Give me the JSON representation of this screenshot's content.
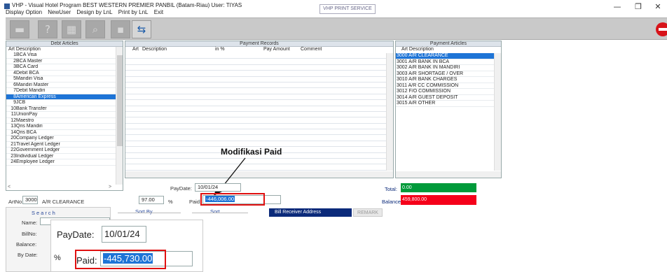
{
  "title_bar": {
    "text": "VHP - Visual Hotel Program      BEST WESTERN PREMIER PANBIL (Batam-Riau) User: TIYAS",
    "print_service": "VHP PRINT SERVICE",
    "minimize": "—",
    "maximize": "❐",
    "close": "✕"
  },
  "menu": [
    "Display Option",
    "NewUser",
    "Design by LnL",
    "Print by LnL",
    "Exit"
  ],
  "toolbar": {
    "icons": [
      "document-icon",
      "help-icon",
      "table-icon",
      "search-icon",
      "grid-icon",
      "swap-icon"
    ],
    "stop_icon": "stop-icon"
  },
  "debt_articles": {
    "header": "Debt Articles",
    "col_art": "Art",
    "col_desc": "Description",
    "rows": [
      {
        "art": "1",
        "desc": "BCA Visa"
      },
      {
        "art": "2",
        "desc": "BCA Master"
      },
      {
        "art": "3",
        "desc": "BCA Card"
      },
      {
        "art": "4",
        "desc": "Debit BCA"
      },
      {
        "art": "5",
        "desc": "Mandiri Visa"
      },
      {
        "art": "6",
        "desc": "Mandiri Master"
      },
      {
        "art": "7",
        "desc": "Debit Mandiri"
      },
      {
        "art": "8",
        "desc": "American Express",
        "selected": true
      },
      {
        "art": "9",
        "desc": "JCB"
      },
      {
        "art": "10",
        "desc": "Bank Transfer"
      },
      {
        "art": "11",
        "desc": "UnionPay"
      },
      {
        "art": "12",
        "desc": "Maestro"
      },
      {
        "art": "13",
        "desc": "Qris Mandiri"
      },
      {
        "art": "14",
        "desc": "Qris BCA"
      },
      {
        "art": "20",
        "desc": "Company Ledger"
      },
      {
        "art": "21",
        "desc": "Travel Agent Ledger"
      },
      {
        "art": "22",
        "desc": "Government Ledger"
      },
      {
        "art": "23",
        "desc": "Individual Ledger"
      },
      {
        "art": "24",
        "desc": "Employee Ledger"
      }
    ]
  },
  "payment_records": {
    "header": "Payment Records",
    "cols": [
      "Art",
      "Description",
      "in %",
      "Pay Amount",
      "Comment"
    ]
  },
  "payment_articles": {
    "header": "Payment Articles",
    "col_art": "Art",
    "col_desc": "Description",
    "rows": [
      {
        "art": "3000",
        "desc": "A/R CLEARANCE",
        "selected": true
      },
      {
        "art": "3001",
        "desc": "A/R BANK IN BCA"
      },
      {
        "art": "3002",
        "desc": "A/R BANK IN MANDIRI"
      },
      {
        "art": "3003",
        "desc": "A/R SHORTAGE / OVER"
      },
      {
        "art": "3010",
        "desc": "A/R BANK CHARGES"
      },
      {
        "art": "3011",
        "desc": "A/R CC COMMISSION"
      },
      {
        "art": "3012",
        "desc": "F/O COMMISSION"
      },
      {
        "art": "3014",
        "desc": "A/R GUEST DEPOSIT"
      },
      {
        "art": "3015",
        "desc": "A/R OTHER"
      }
    ]
  },
  "annotation": "Modifikasi Paid",
  "form": {
    "artno_label": "ArtNo:",
    "artno_value": "3000",
    "artno_desc": "A/R CLEARANCE",
    "percent_value": "97.00",
    "percent_label": "%",
    "paydate_label": "PayDate:",
    "paydate_value": "10/01/24",
    "paid_label": "Paid:",
    "paid_value": "-446,006.00",
    "total_label": "Total:",
    "total_value": "0.00",
    "balance_label": "Balance:",
    "balance_value": "459,800.00",
    "search_title": "Search",
    "sort_by": "Sort By",
    "sort": "Sort",
    "name_label": "Name:",
    "billno_label": "BillNo:",
    "balance_small_label": "Balance:",
    "bydate_label": "By Date:",
    "bill_receiver": "Bill Receiver Address",
    "remark": "REMARK"
  },
  "zoom": {
    "paydate_label": "PayDate:",
    "paydate_value": "10/01/24",
    "percent_label": "%",
    "paid_label": "Paid:",
    "paid_value": "-445,730.00"
  }
}
